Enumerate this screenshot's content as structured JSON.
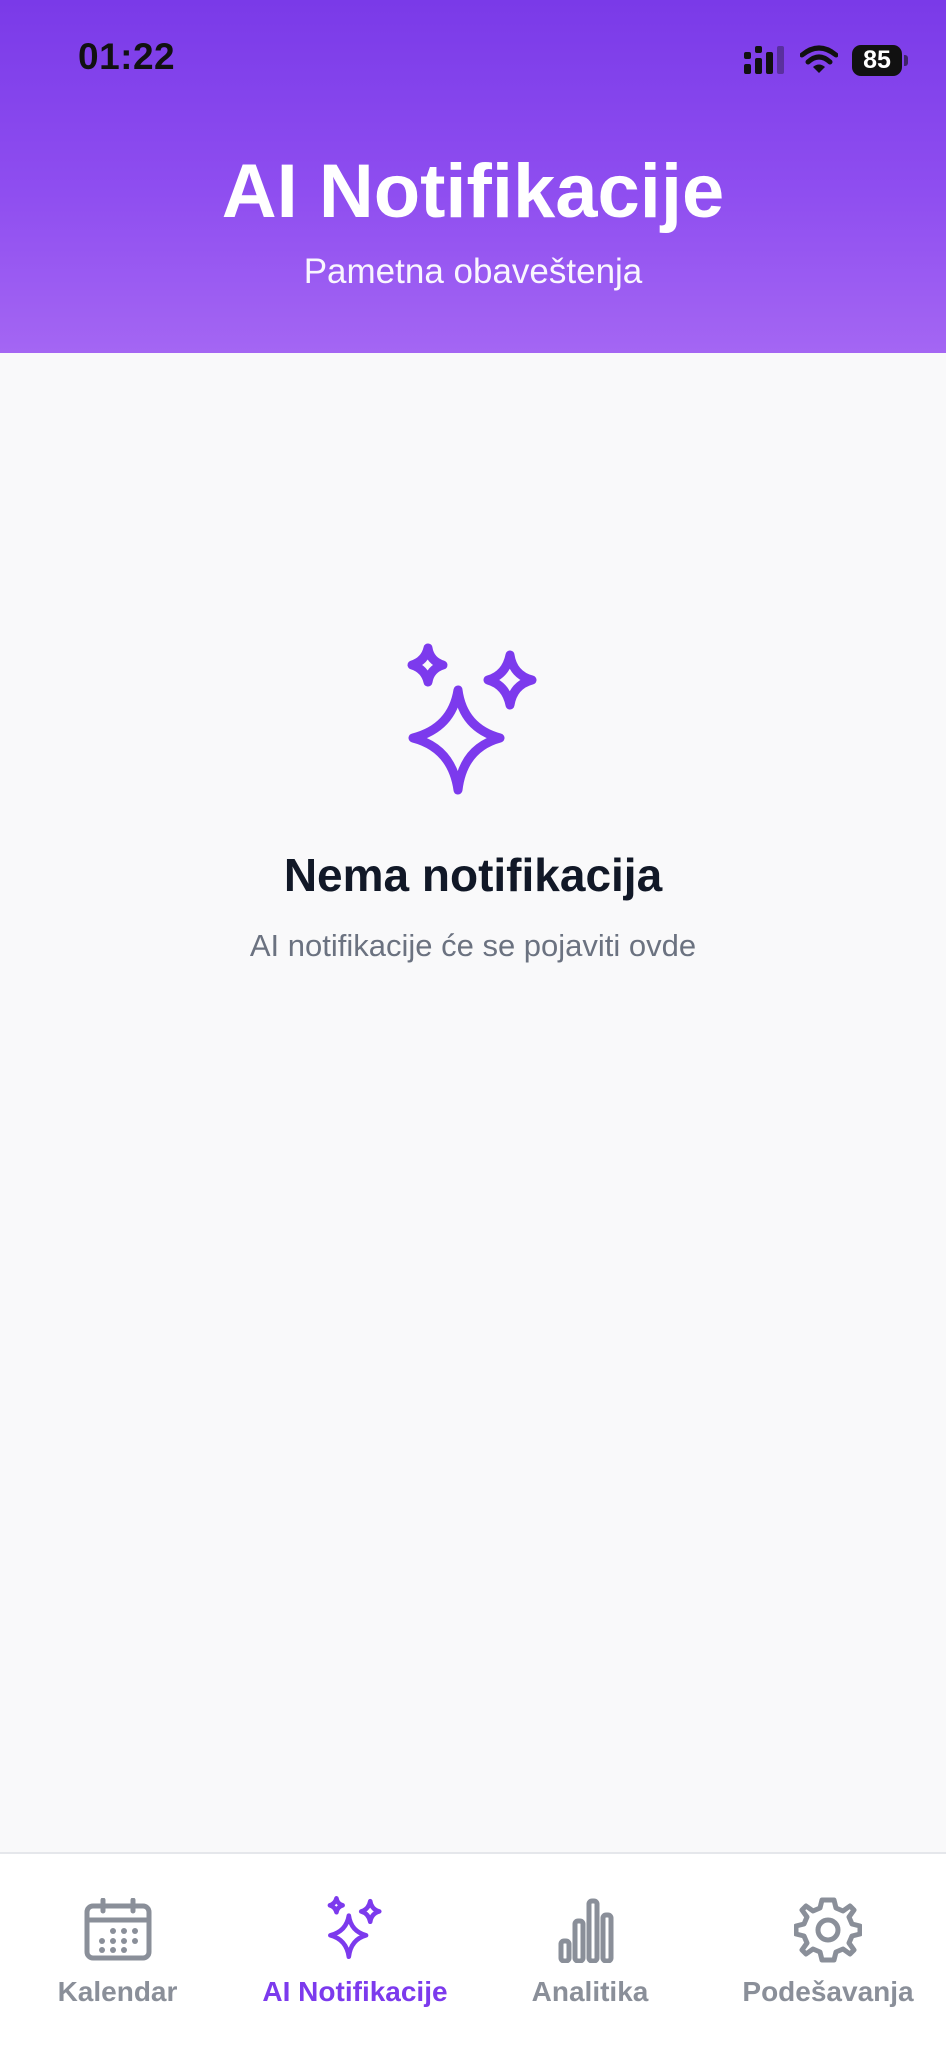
{
  "status_bar": {
    "time": "01:22",
    "battery": "85"
  },
  "header": {
    "title": "AI Notifikacije",
    "subtitle": "Pametna obaveštenja"
  },
  "empty_state": {
    "icon": "sparkles-icon",
    "title": "Nema notifikacija",
    "text": "AI notifikacije će se pojaviti ovde"
  },
  "tab_bar": {
    "active_color": "#7c3aed",
    "inactive_color": "#8a8f99",
    "items": [
      {
        "label": "Kalendar",
        "icon": "calendar-icon",
        "active": false
      },
      {
        "label": "AI Notifikacije",
        "icon": "sparkles-icon",
        "active": true
      },
      {
        "label": "Analitika",
        "icon": "bar-chart-icon",
        "active": false
      },
      {
        "label": "Podešavanja",
        "icon": "gear-icon",
        "active": false
      }
    ]
  },
  "colors": {
    "header_gradient_top": "#7a3ae8",
    "header_gradient_bottom": "#a466f3",
    "accent": "#7c3aed",
    "background": "#f9f9fa"
  }
}
